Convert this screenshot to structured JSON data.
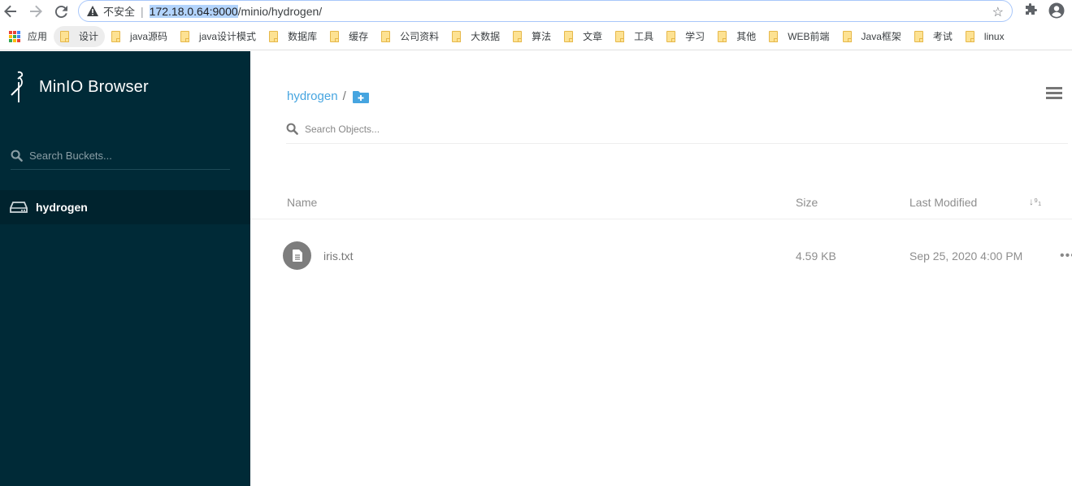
{
  "browser": {
    "security_label": "不安全",
    "url_host": "172.18.0.64:9000",
    "url_path": "/minio/hydrogen/",
    "bookmarks": [
      {
        "label": "应用",
        "type": "apps"
      },
      {
        "label": "设计",
        "type": "folder"
      },
      {
        "label": "java源码",
        "type": "folder"
      },
      {
        "label": "java设计模式",
        "type": "folder"
      },
      {
        "label": "数据库",
        "type": "folder"
      },
      {
        "label": "缓存",
        "type": "folder"
      },
      {
        "label": "公司资料",
        "type": "folder"
      },
      {
        "label": "大数据",
        "type": "folder"
      },
      {
        "label": "算法",
        "type": "folder"
      },
      {
        "label": "文章",
        "type": "folder"
      },
      {
        "label": "工具",
        "type": "folder"
      },
      {
        "label": "学习",
        "type": "folder"
      },
      {
        "label": "其他",
        "type": "folder"
      },
      {
        "label": "WEB前端",
        "type": "folder"
      },
      {
        "label": "Java框架",
        "type": "folder"
      },
      {
        "label": "考试",
        "type": "folder"
      },
      {
        "label": "linux",
        "type": "folder"
      }
    ]
  },
  "sidebar": {
    "title": "MinIO Browser",
    "search_placeholder": "Search Buckets...",
    "buckets": [
      {
        "name": "hydrogen",
        "active": true
      }
    ]
  },
  "main": {
    "breadcrumb": [
      {
        "label": "hydrogen"
      }
    ],
    "breadcrumb_sep": "/",
    "search_placeholder": "Search Objects...",
    "columns": {
      "name": "Name",
      "size": "Size",
      "modified": "Last Modified"
    },
    "objects": [
      {
        "name": "iris.txt",
        "size": "4.59 KB",
        "modified": "Sep 25, 2020 4:00 PM"
      }
    ]
  },
  "colors": {
    "sidebar_bg": "#002a37",
    "accent": "#46a5e0"
  }
}
